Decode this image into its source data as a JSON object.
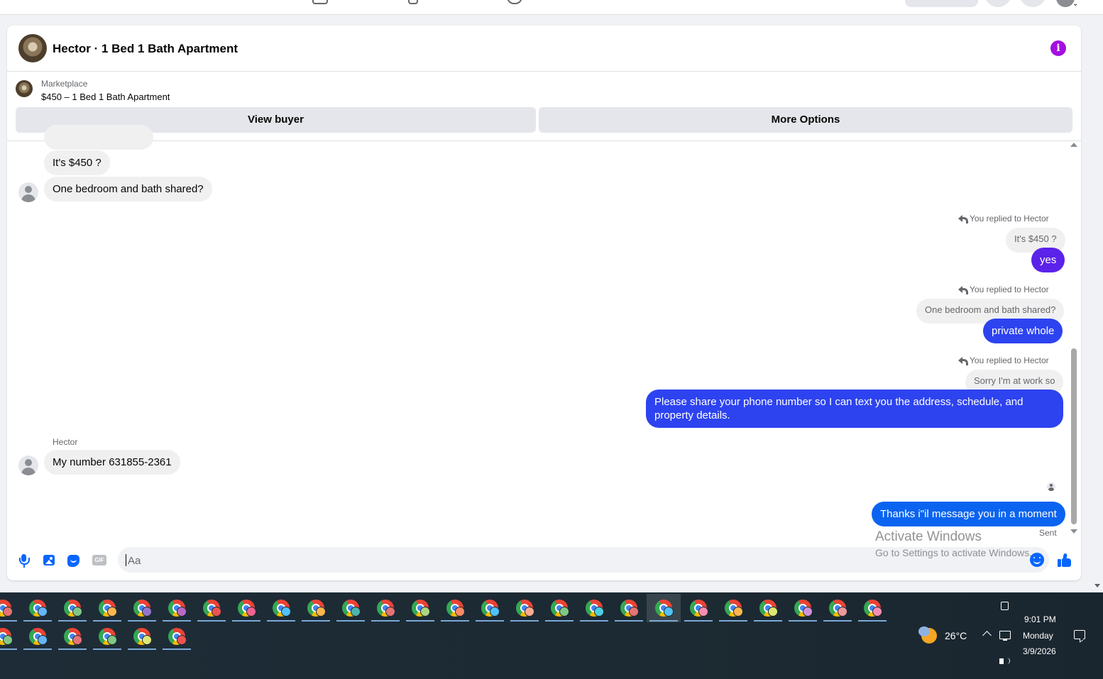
{
  "chat": {
    "title": "Hector · 1 Bed 1 Bath Apartment",
    "marketplace_label": "Marketplace",
    "listing": "$450 – 1 Bed 1 Bath Apartment",
    "view_buyer_label": "View buyer",
    "more_options_label": "More Options",
    "info_glyph": "i"
  },
  "messages": {
    "m1": "It's $450 ?",
    "m2": "One bedroom and bath shared?",
    "reply1_note": "You replied to Hector",
    "reply1_quote": "It's $450 ?",
    "reply1_text": "yes",
    "reply2_note": "You replied to Hector",
    "reply2_quote": "One bedroom and bath shared?",
    "reply2_text": "private whole",
    "reply3_note": "You replied to Hector",
    "reply3_quote": "Sorry I'm at work so",
    "reply3_text_line1": "Please share your phone number so I can text you the address, schedule, and",
    "reply3_text_line2": "property details.",
    "sender_name": "Hector",
    "m3": "My number 631855-2361",
    "last_sent": "Thanks i\"il message you in a moment",
    "status": "Sent"
  },
  "composer": {
    "placeholder": "Aa",
    "gif_label": "GIF"
  },
  "watermark": {
    "line1": "Activate Windows",
    "line2": "Go to Settings to activate Windows."
  },
  "taskbar": {
    "row1_badges": [
      "#e57373",
      "#64b5f6",
      "#81c784",
      "#ffb74d",
      "#9575cd",
      "#ba68c8",
      "#ef5350",
      "#f06292",
      "#4fc3f7",
      "#ffb74d",
      "#4db6ac",
      "#e57373",
      "#aed581",
      "#ff8a65",
      "#4fc3f7",
      "#ffab91",
      "#81c784",
      "#4dd0e1",
      "#e57373",
      "#4fc3f7",
      "#f48fb1",
      "#ffb74d",
      "#dce775",
      "#ce93d8",
      "#ef9a9a",
      "#f48fb1"
    ],
    "row2_badges": [
      "#81c784",
      "#64b5f6",
      "#e57373",
      "#81c784",
      "#dce775",
      "#ef5350"
    ],
    "active_index": 19
  },
  "tray": {
    "temperature": "26°C",
    "time": "9:01 PM",
    "day": "Monday",
    "date": "3/9/2026"
  },
  "colors": {
    "info": "#a40ee0",
    "bubble_purple": "#5b22ea",
    "bubble_indigo": "#2d43f0",
    "bubble_blue": "#0a64f0",
    "accent": "#0866ff"
  }
}
